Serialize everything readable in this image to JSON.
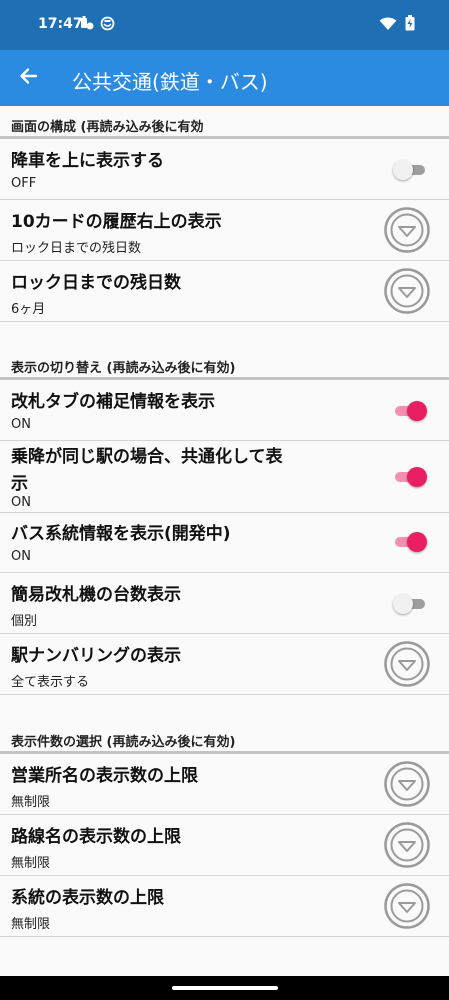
{
  "status_bar": {
    "time": "17:47",
    "left_icons": [
      "notification-icon",
      "app-status-icon"
    ],
    "right_icons": [
      "wifi-icon",
      "battery-icon"
    ]
  },
  "app_bar": {
    "title": "公共交通(鉄道・バス)",
    "back_icon": "arrow-back-icon"
  },
  "sections": [
    {
      "header": "画面の構成 (再読み込み後に有効",
      "items": [
        {
          "title": "降車を上に表示する",
          "value": "OFF",
          "control": "toggle",
          "on": false
        },
        {
          "title": "10カードの履歴右上の表示",
          "value": "ロック日までの残日数",
          "control": "dropdown"
        },
        {
          "title": "ロック日までの残日数",
          "value": "6ヶ月",
          "control": "dropdown"
        }
      ]
    },
    {
      "header": "表示の切り替え (再読み込み後に有効)",
      "items": [
        {
          "title": "改札タブの補足情報を表示",
          "value": "ON",
          "control": "toggle",
          "on": true
        },
        {
          "title_line1": "乗降が同じ駅の場合、共通化して表",
          "title_line2": "示",
          "value": "ON",
          "control": "toggle",
          "on": true
        },
        {
          "title": "バス系統情報を表示(開発中)",
          "value": "ON",
          "control": "toggle",
          "on": true
        },
        {
          "title": "簡易改札機の台数表示",
          "value": "個別",
          "control": "toggle",
          "on": false
        },
        {
          "title": "駅ナンバリングの表示",
          "value": "全て表示する",
          "control": "dropdown"
        }
      ]
    },
    {
      "header": "表示件数の選択 (再読み込み後に有効)",
      "items": [
        {
          "title": "営業所名の表示数の上限",
          "value": "無制限",
          "control": "dropdown"
        },
        {
          "title": "路線名の表示数の上限",
          "value": "無制限",
          "control": "dropdown"
        },
        {
          "title": "系統の表示数の上限",
          "value": "無制限",
          "control": "dropdown"
        }
      ]
    }
  ],
  "colors": {
    "status_bar": "#1e6fb3",
    "app_bar": "#2b8be0",
    "toggle_on": "#e91e63",
    "toggle_on_track": "#f48fb1",
    "toggle_off_thumb": "#f1f1f1",
    "toggle_off_track": "#9e9e9e",
    "background": "#fafafa"
  }
}
